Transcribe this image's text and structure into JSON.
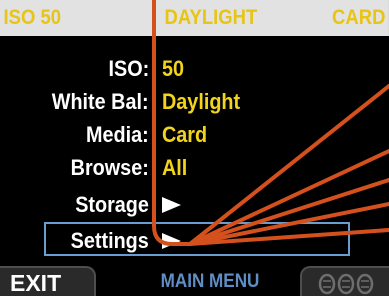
{
  "status_bar": {
    "iso": "ISO 50",
    "white_balance": "DAYLIGHT",
    "media": "CARD"
  },
  "menu": {
    "items": [
      {
        "label": "ISO:",
        "value": "50"
      },
      {
        "label": "White Bal:",
        "value": "Daylight"
      },
      {
        "label": "Media:",
        "value": "Card"
      },
      {
        "label": "Browse:",
        "value": "All"
      },
      {
        "label": "Storage"
      },
      {
        "label": "Settings"
      }
    ],
    "selected": "Settings"
  },
  "bottom_bar": {
    "exit_label": "EXIT",
    "title": "MAIN MENU",
    "dial_icon": "dial-icon"
  },
  "colors": {
    "status_bg": "#e2e2e2",
    "status_text": "#e8c414",
    "value_text": "#f2d41a",
    "selection_border": "#6a9ed0",
    "callout_line": "#d4501c",
    "title_text": "#5f8ec4"
  }
}
